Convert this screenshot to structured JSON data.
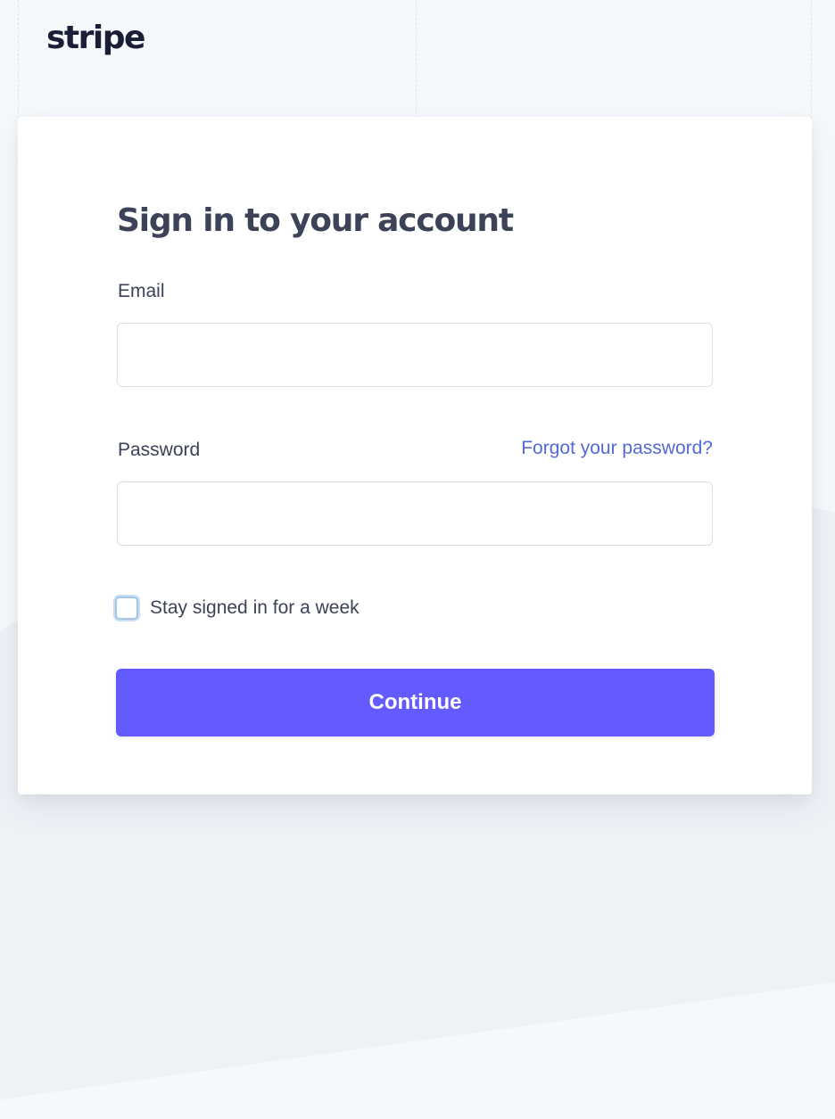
{
  "brand": {
    "logo_text": "stripe",
    "accent_color": "#635bff",
    "link_color": "#5469d4"
  },
  "signin": {
    "title": "Sign in to your account",
    "email": {
      "label": "Email",
      "value": "",
      "placeholder": ""
    },
    "password": {
      "label": "Password",
      "value": "",
      "placeholder": "",
      "forgot_link": "Forgot your password?"
    },
    "remember": {
      "label": "Stay signed in for a week",
      "checked": false
    },
    "continue_label": "Continue"
  }
}
